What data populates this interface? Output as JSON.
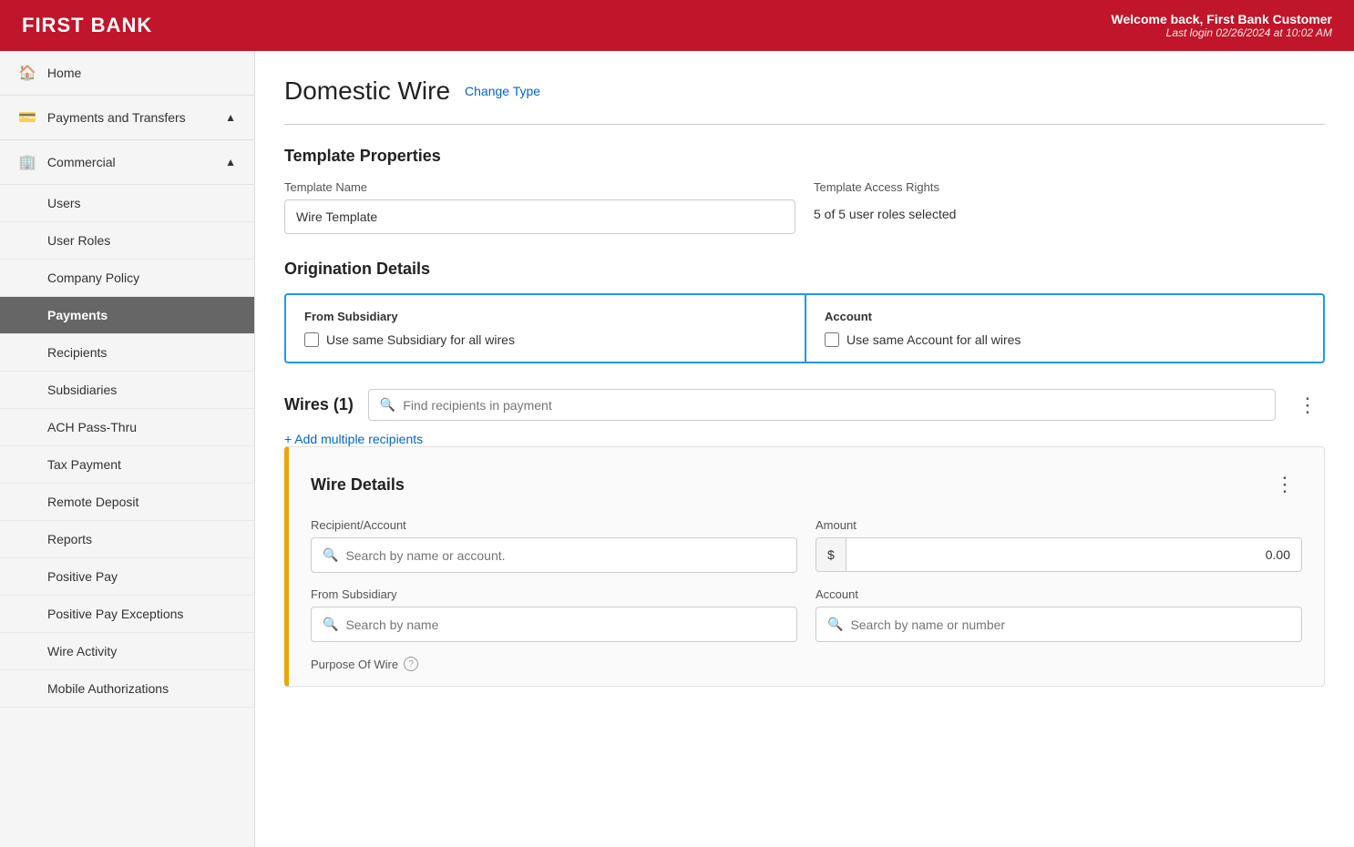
{
  "header": {
    "logo": "FIRST BANK",
    "welcome": "Welcome back, First Bank Customer",
    "last_login": "Last login 02/26/2024 at 10:02 AM"
  },
  "sidebar": {
    "items": [
      {
        "id": "home",
        "label": "Home",
        "icon": "🏠",
        "level": "top"
      },
      {
        "id": "payments-transfers",
        "label": "Payments and Transfers",
        "icon": "💳",
        "level": "top",
        "has_chevron": true,
        "chevron": "▲"
      },
      {
        "id": "commercial",
        "label": "Commercial",
        "icon": "🏢",
        "level": "top",
        "has_chevron": true,
        "chevron": "▲"
      },
      {
        "id": "users",
        "label": "Users",
        "level": "sub"
      },
      {
        "id": "user-roles",
        "label": "User Roles",
        "level": "sub"
      },
      {
        "id": "company-policy",
        "label": "Company Policy",
        "level": "sub"
      },
      {
        "id": "payments",
        "label": "Payments",
        "level": "sub",
        "active": true
      },
      {
        "id": "recipients",
        "label": "Recipients",
        "level": "sub"
      },
      {
        "id": "subsidiaries",
        "label": "Subsidiaries",
        "level": "sub"
      },
      {
        "id": "ach-pass-thru",
        "label": "ACH Pass-Thru",
        "level": "sub"
      },
      {
        "id": "tax-payment",
        "label": "Tax Payment",
        "level": "sub"
      },
      {
        "id": "remote-deposit",
        "label": "Remote Deposit",
        "level": "sub"
      },
      {
        "id": "reports",
        "label": "Reports",
        "level": "sub"
      },
      {
        "id": "positive-pay",
        "label": "Positive Pay",
        "level": "sub"
      },
      {
        "id": "positive-pay-exceptions",
        "label": "Positive Pay Exceptions",
        "level": "sub"
      },
      {
        "id": "wire-activity",
        "label": "Wire Activity",
        "level": "sub"
      },
      {
        "id": "mobile-authorizations",
        "label": "Mobile Authorizations",
        "level": "sub"
      }
    ]
  },
  "main": {
    "page_title": "Domestic Wire",
    "change_type_link": "Change Type",
    "sections": {
      "template_properties": {
        "title": "Template Properties",
        "template_name_label": "Template Name",
        "template_name_value": "Wire Template",
        "template_access_label": "Template Access Rights",
        "template_access_value": "5 of 5 user roles selected"
      },
      "origination_details": {
        "title": "Origination Details",
        "from_subsidiary": {
          "label": "From Subsidiary",
          "checkbox_label": "Use same Subsidiary for all wires"
        },
        "account": {
          "label": "Account",
          "checkbox_label": "Use same Account for all wires"
        }
      },
      "wires": {
        "title": "Wires (1)",
        "search_placeholder": "Find recipients in payment",
        "add_multiple": "+ Add multiple recipients",
        "wire_details": {
          "title": "Wire Details",
          "recipient_account_label": "Recipient/Account",
          "recipient_account_placeholder": "Search by name or account.",
          "amount_label": "Amount",
          "amount_currency": "$",
          "amount_value": "0.00",
          "from_subsidiary_label": "From Subsidiary",
          "from_subsidiary_placeholder": "Search by name",
          "account_label": "Account",
          "account_placeholder": "Search by name or number",
          "purpose_of_wire_label": "Purpose Of Wire"
        }
      }
    }
  }
}
